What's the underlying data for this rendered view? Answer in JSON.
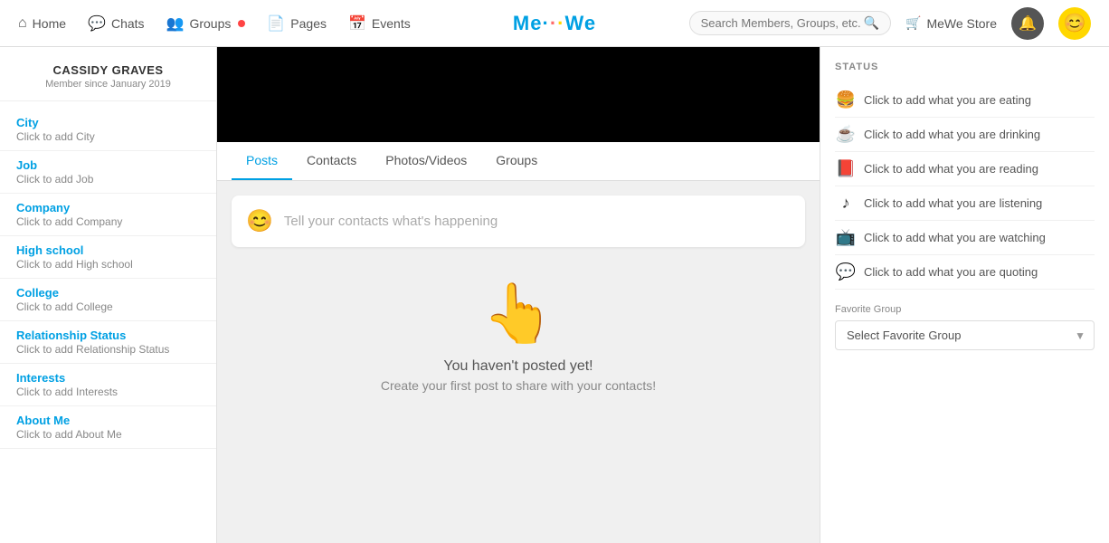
{
  "nav": {
    "items": [
      {
        "id": "home",
        "label": "Home",
        "icon": "⌂"
      },
      {
        "id": "chats",
        "label": "Chats",
        "icon": "💬"
      },
      {
        "id": "groups",
        "label": "Groups",
        "icon": "👥",
        "dot": true
      },
      {
        "id": "pages",
        "label": "Pages",
        "icon": "📄"
      },
      {
        "id": "events",
        "label": "Events",
        "icon": "📅"
      }
    ],
    "logo": "MeWe",
    "search_placeholder": "Search Members, Groups, etc.",
    "store_label": "MeWe Store",
    "bell_icon": "🔔",
    "avatar_emoji": "😊"
  },
  "sidebar": {
    "user_name": "CASSIDY GRAVES",
    "member_since": "Member since January 2019",
    "fields": [
      {
        "id": "city",
        "label": "City",
        "value": "Click to add City"
      },
      {
        "id": "job",
        "label": "Job",
        "value": "Click to add Job"
      },
      {
        "id": "company",
        "label": "Company",
        "value": "Click to add Company"
      },
      {
        "id": "highschool",
        "label": "High school",
        "value": "Click to add High school"
      },
      {
        "id": "college",
        "label": "College",
        "value": "Click to add College"
      },
      {
        "id": "relationship",
        "label": "Relationship Status",
        "value": "Click to add Relationship Status"
      },
      {
        "id": "interests",
        "label": "Interests",
        "value": "Click to add Interests"
      },
      {
        "id": "aboutme",
        "label": "About Me",
        "value": "Click to add About Me"
      }
    ]
  },
  "tabs": [
    {
      "id": "posts",
      "label": "Posts",
      "active": true
    },
    {
      "id": "contacts",
      "label": "Contacts",
      "active": false
    },
    {
      "id": "photos",
      "label": "Photos/Videos",
      "active": false
    },
    {
      "id": "groups",
      "label": "Groups",
      "active": false
    }
  ],
  "post_box": {
    "placeholder": "Tell your contacts what's happening",
    "avatar_emoji": "😊"
  },
  "empty_state": {
    "icon": "👆",
    "title": "You haven't posted yet!",
    "subtitle": "Create your first post to share with your contacts!"
  },
  "status_panel": {
    "title": "STATUS",
    "items": [
      {
        "id": "eating",
        "emoji": "🍔",
        "text": "Click to add what you are eating"
      },
      {
        "id": "drinking",
        "emoji": "☕",
        "text": "Click to add what you are drinking"
      },
      {
        "id": "reading",
        "emoji": "📕",
        "text": "Click to add what you are reading"
      },
      {
        "id": "listening",
        "emoji": "♪",
        "text": "Click to add what you are listening"
      },
      {
        "id": "watching",
        "emoji": "📺",
        "text": "Click to add what you are watching"
      },
      {
        "id": "quoting",
        "emoji": "💬",
        "text": "Click to add what you are quoting"
      }
    ],
    "favorite_group_label": "Favorite Group",
    "favorite_group_placeholder": "Select Favorite Group"
  }
}
